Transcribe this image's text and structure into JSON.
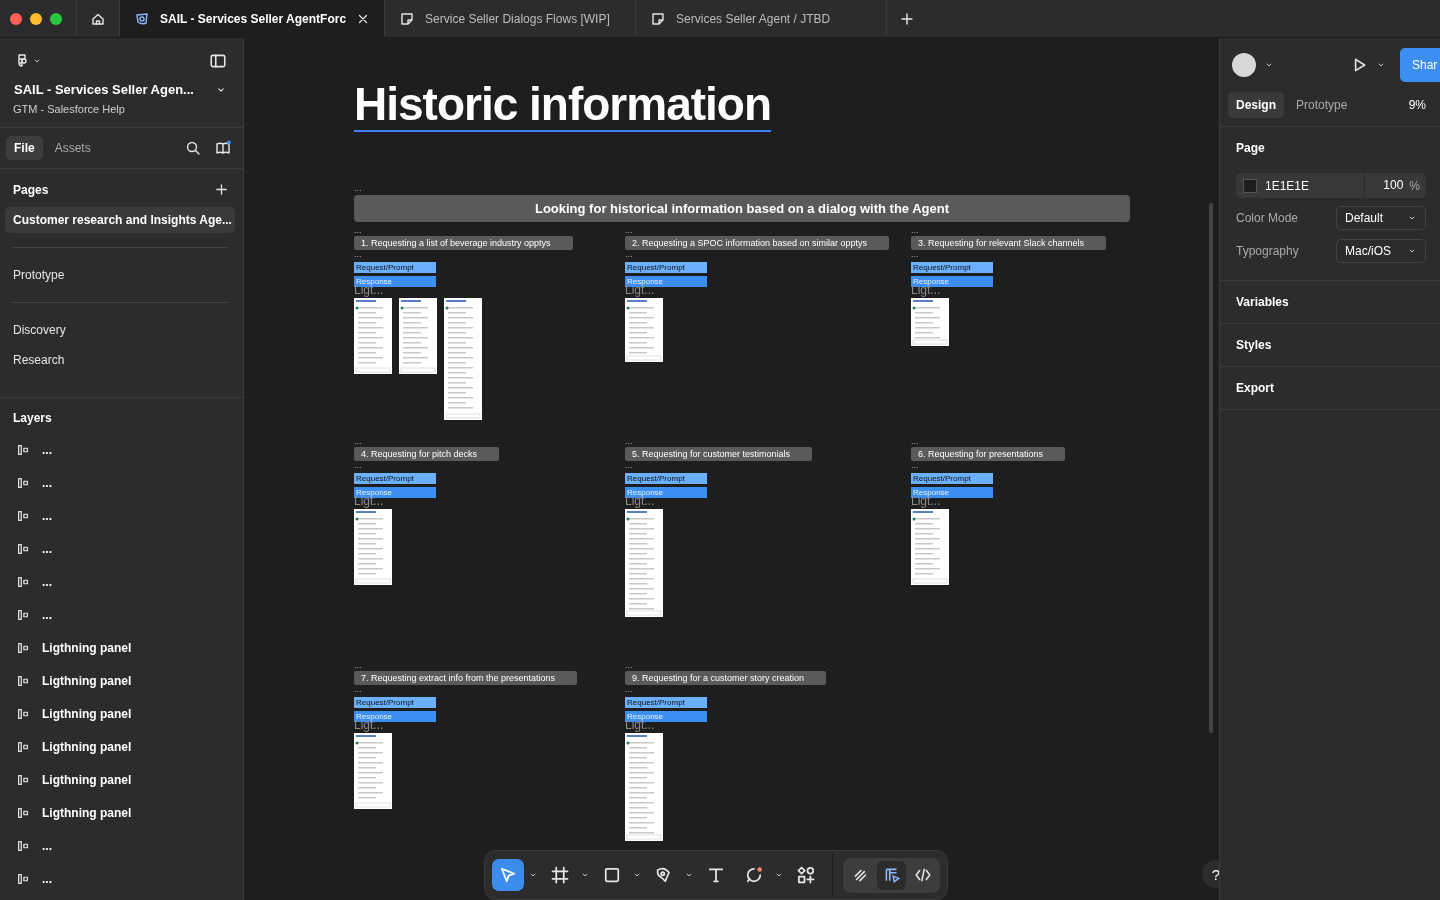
{
  "tabs": [
    {
      "title": "SAIL - Services Seller AgentForc",
      "kind": "design",
      "selected": true
    },
    {
      "title": "Service Seller Dialogs Flows [WIP]",
      "kind": "board",
      "selected": false
    },
    {
      "title": "Services Seller Agent / JTBD",
      "kind": "board",
      "selected": false
    }
  ],
  "file": {
    "name": "SAIL - Services Seller Agen...",
    "team": "GTM - Salesforce Help"
  },
  "panel_tabs": [
    {
      "label": "File",
      "selected": true
    },
    {
      "label": "Assets",
      "selected": false
    }
  ],
  "pages": {
    "title": "Pages",
    "items": [
      {
        "kind": "page",
        "label": "Customer research and Insights Age...",
        "selected": true
      },
      {
        "kind": "divider"
      },
      {
        "kind": "page",
        "label": "Prototype",
        "selected": false
      },
      {
        "kind": "divider"
      },
      {
        "kind": "page",
        "label": "Discovery",
        "selected": false
      },
      {
        "kind": "page",
        "label": "Research",
        "selected": false
      }
    ]
  },
  "layers": {
    "title": "Layers",
    "items": [
      {
        "label": "..."
      },
      {
        "label": "..."
      },
      {
        "label": "..."
      },
      {
        "label": "..."
      },
      {
        "label": "..."
      },
      {
        "label": "..."
      },
      {
        "label": "Ligthning panel"
      },
      {
        "label": "Ligthning panel"
      },
      {
        "label": "Ligthning panel"
      },
      {
        "label": "Ligthning panel"
      },
      {
        "label": "Ligthning panel"
      },
      {
        "label": "Ligthning panel"
      },
      {
        "label": "..."
      },
      {
        "label": "..."
      }
    ]
  },
  "canvas": {
    "title": "Historic information",
    "banner_mark": "...",
    "banner": "Looking for historical information based on a  dialog with the Agent",
    "sections": [
      {
        "mark": "...",
        "title": "1. Requesting a list of beverage industry opptys",
        "prompt": "Request/Prompt",
        "response": "Response",
        "caption": "Ligt...",
        "thumbnails": [
          {
            "kind": "medium"
          },
          {
            "kind": "medium"
          },
          {
            "kind": "xtall"
          }
        ]
      },
      {
        "mark": "...",
        "title": "2. Requesting a SPOC information based on similar opptys",
        "prompt": "Request/Prompt",
        "response": "Response",
        "caption": "Ligt...",
        "thumbnails": [
          {
            "kind": "short"
          }
        ]
      },
      {
        "mark": "...",
        "title": "3. Requesting for relevant Slack channels",
        "prompt": "Request/Prompt",
        "response": "Response",
        "caption": "Ligt...",
        "thumbnails": [
          {
            "kind": "small"
          }
        ]
      },
      {
        "mark": "...",
        "title": "4. Requesting for pitch decks",
        "prompt": "Request/Prompt",
        "response": "Response",
        "caption": "Ligt...",
        "thumbnails": [
          {
            "kind": "medium"
          }
        ]
      },
      {
        "mark": "...",
        "title": "5. Requesting for customer testimonials",
        "prompt": "Request/Prompt",
        "response": "Response",
        "caption": "Ligt...",
        "thumbnails": [
          {
            "kind": "tall"
          }
        ]
      },
      {
        "mark": "...",
        "title": "6. Requesting for presentations",
        "prompt": "Request/Prompt",
        "response": "Response",
        "caption": "Ligt...",
        "thumbnails": [
          {
            "kind": "medium"
          }
        ]
      },
      {
        "mark": "...",
        "title": "7. Requesting extract info from the presentations",
        "prompt": "Request/Prompt",
        "response": "Response",
        "caption": "Ligt...",
        "thumbnails": [
          {
            "kind": "medium"
          }
        ]
      },
      {
        "mark": "...",
        "title": "9. Requesting for a customer story creation",
        "prompt": "Request/Prompt",
        "response": "Response",
        "caption": "Ligt...",
        "thumbnails": [
          {
            "kind": "tall"
          }
        ]
      }
    ]
  },
  "toolbar": {
    "tools": [
      {
        "kind": "move",
        "selected": true,
        "menu": true
      },
      {
        "kind": "frame",
        "selected": false,
        "menu": true
      },
      {
        "kind": "rectangle",
        "selected": false,
        "menu": true
      },
      {
        "kind": "pen",
        "selected": false,
        "menu": true
      },
      {
        "kind": "text",
        "selected": false,
        "menu": false
      },
      {
        "kind": "comment",
        "selected": false,
        "menu": true
      },
      {
        "kind": "actions",
        "selected": false,
        "menu": false
      }
    ],
    "modes": [
      {
        "kind": "draw",
        "selected": false
      },
      {
        "kind": "design",
        "selected": true
      },
      {
        "kind": "dev",
        "selected": false
      }
    ]
  },
  "inspector": {
    "share": "Shar",
    "tabs": [
      {
        "label": "Design",
        "selected": true
      },
      {
        "label": "Prototype",
        "selected": false
      }
    ],
    "zoom": "9%",
    "page": {
      "title": "Page",
      "color": "1E1E1E",
      "opacity": "100",
      "unit": "%"
    },
    "settings": [
      {
        "label": "Color Mode",
        "value": "Default"
      },
      {
        "label": "Typography",
        "value": "Mac/iOS"
      }
    ],
    "sections": [
      "Variables",
      "Styles",
      "Export"
    ]
  },
  "help": "?"
}
